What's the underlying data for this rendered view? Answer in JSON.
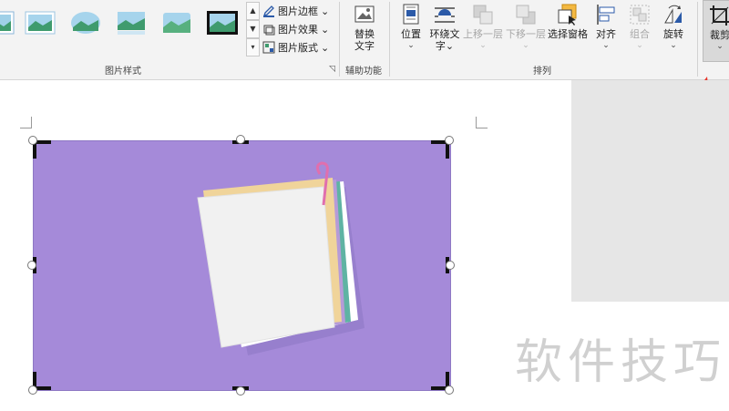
{
  "ribbon": {
    "picture_styles_group": "图片样式",
    "border_label": "图片边框",
    "effects_label": "图片效果",
    "layout_label": "图片版式",
    "alt_text": {
      "line1": "替换",
      "line2": "文字",
      "group": "辅助功能"
    },
    "arrange": {
      "group": "排列",
      "position": "位置",
      "wrap_line1": "环绕文",
      "wrap_line2": "字",
      "bring_forward": "上移一层",
      "send_backward": "下移一层",
      "selection_pane": "选择窗格",
      "align": "对齐",
      "group_btn": "组合",
      "rotate": "旋转"
    },
    "crop": "裁剪"
  },
  "watermark": "软件技巧",
  "colors": {
    "image_bg": "#a58ad9",
    "annotation_arrow": "#e8362b"
  }
}
